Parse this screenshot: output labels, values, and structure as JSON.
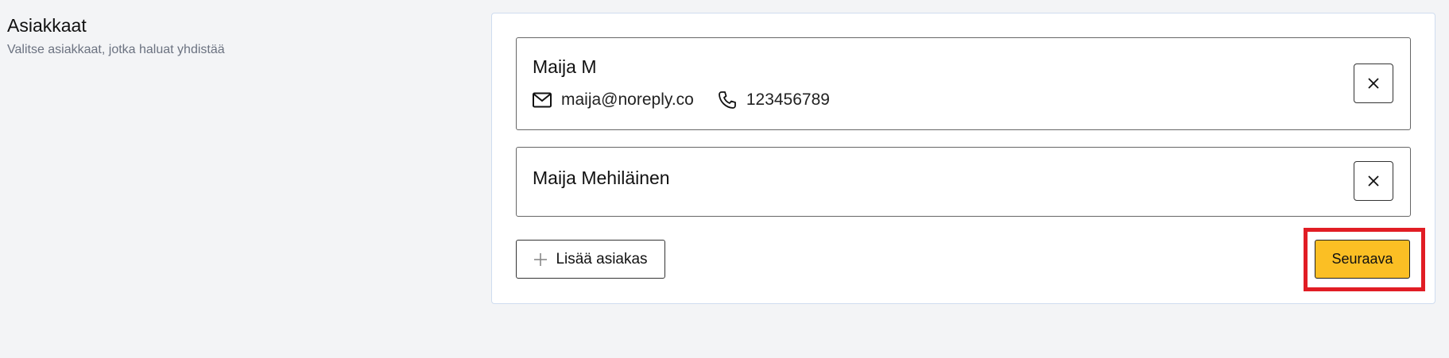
{
  "section": {
    "title": "Asiakkaat",
    "subtitle": "Valitse asiakkaat, jotka haluat yhdistää"
  },
  "customers": [
    {
      "name": "Maija M",
      "email": "maija@noreply.co",
      "phone": "123456789"
    },
    {
      "name": "Maija Mehiläinen"
    }
  ],
  "actions": {
    "add_customer_label": "Lisää asiakas",
    "next_label": "Seuraava"
  },
  "colors": {
    "accent": "#fbbf24",
    "highlight": "#e11d24",
    "panel_border": "#cfdcef"
  },
  "icons": {
    "email": "envelope-icon",
    "phone": "phone-icon",
    "remove": "close-icon",
    "add": "plus-icon"
  }
}
